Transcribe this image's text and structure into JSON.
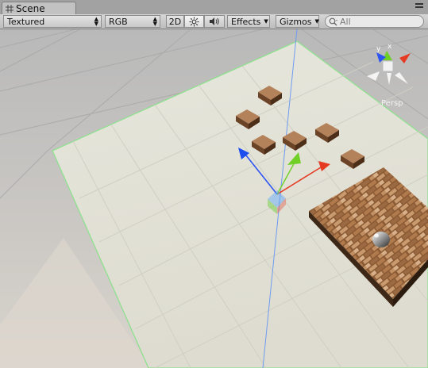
{
  "tab": {
    "label": "Scene"
  },
  "toolbar": {
    "render_mode": "Textured",
    "color_mode": "RGB",
    "mode_2d": "2D",
    "effects": "Effects",
    "gizmos": "Gizmos",
    "search_placeholder": "All"
  },
  "scene": {
    "axis_labels": {
      "y": "y",
      "x": "x"
    },
    "view_label": "Persp"
  },
  "icons": [
    "grid-icon",
    "sun-icon",
    "speaker-icon",
    "search-icon",
    "dropdown-icon"
  ],
  "colors": {
    "toolbar_bg": "#c4c4c4",
    "plane": "#e4e4d8",
    "ground": "#c9c6c0",
    "axis_x": "#e53b22",
    "axis_y": "#70d025",
    "axis_z": "#1c4ef0"
  }
}
